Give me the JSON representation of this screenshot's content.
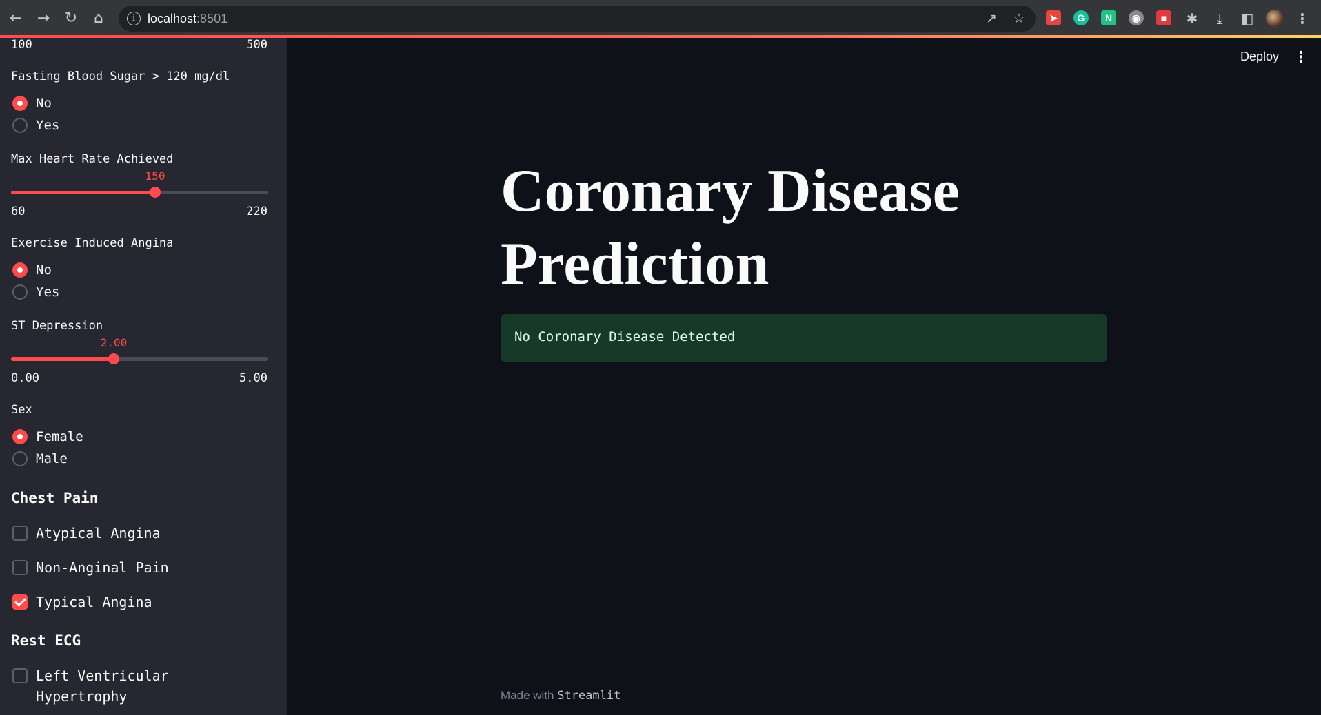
{
  "browser": {
    "url_host": "localhost",
    "url_port": ":8501"
  },
  "sidebar": {
    "cholesterol_slider": {
      "min": "100",
      "max": "500"
    },
    "fasting_blood_sugar": {
      "label": "Fasting Blood Sugar > 120 mg/dl",
      "options": [
        "No",
        "Yes"
      ],
      "selected": "No"
    },
    "max_heart_rate": {
      "label": "Max Heart Rate Achieved",
      "value": "150",
      "min": "60",
      "max": "220",
      "fraction": 0.5625
    },
    "exercise_angina": {
      "label": "Exercise Induced Angina",
      "options": [
        "No",
        "Yes"
      ],
      "selected": "No"
    },
    "st_depression": {
      "label": "ST Depression",
      "value": "2.00",
      "min": "0.00",
      "max": "5.00",
      "fraction": 0.4
    },
    "sex": {
      "label": "Sex",
      "options": [
        "Female",
        "Male"
      ],
      "selected": "Female"
    },
    "chest_pain": {
      "heading": "Chest Pain",
      "items": [
        {
          "label": "Atypical Angina",
          "checked": false
        },
        {
          "label": "Non-Anginal Pain",
          "checked": false
        },
        {
          "label": "Typical Angina",
          "checked": true
        }
      ]
    },
    "rest_ecg": {
      "heading": "Rest ECG",
      "items": [
        {
          "label": "Left Ventricular Hypertrophy",
          "checked": false
        }
      ]
    }
  },
  "main": {
    "deploy_label": "Deploy",
    "title": "Coronary Disease Prediction",
    "result": "No Coronary Disease Detected",
    "footer_prefix": "Made with",
    "footer_brand": "Streamlit"
  },
  "colors": {
    "accent": "#ff4b4b",
    "sidebar_bg": "#262730",
    "main_bg": "#0e1117",
    "success_bg": "#173928",
    "success_text": "#dffde9"
  },
  "icons": {
    "nav": [
      "back-icon",
      "forward-icon",
      "reload-icon",
      "home-icon"
    ],
    "omnibox": [
      "site-info-icon",
      "share-icon",
      "bookmark-star-icon"
    ],
    "toolbar": [
      "extensions-icon",
      "download-icon",
      "side-panel-icon",
      "profile-avatar",
      "chrome-menu-icon"
    ]
  }
}
